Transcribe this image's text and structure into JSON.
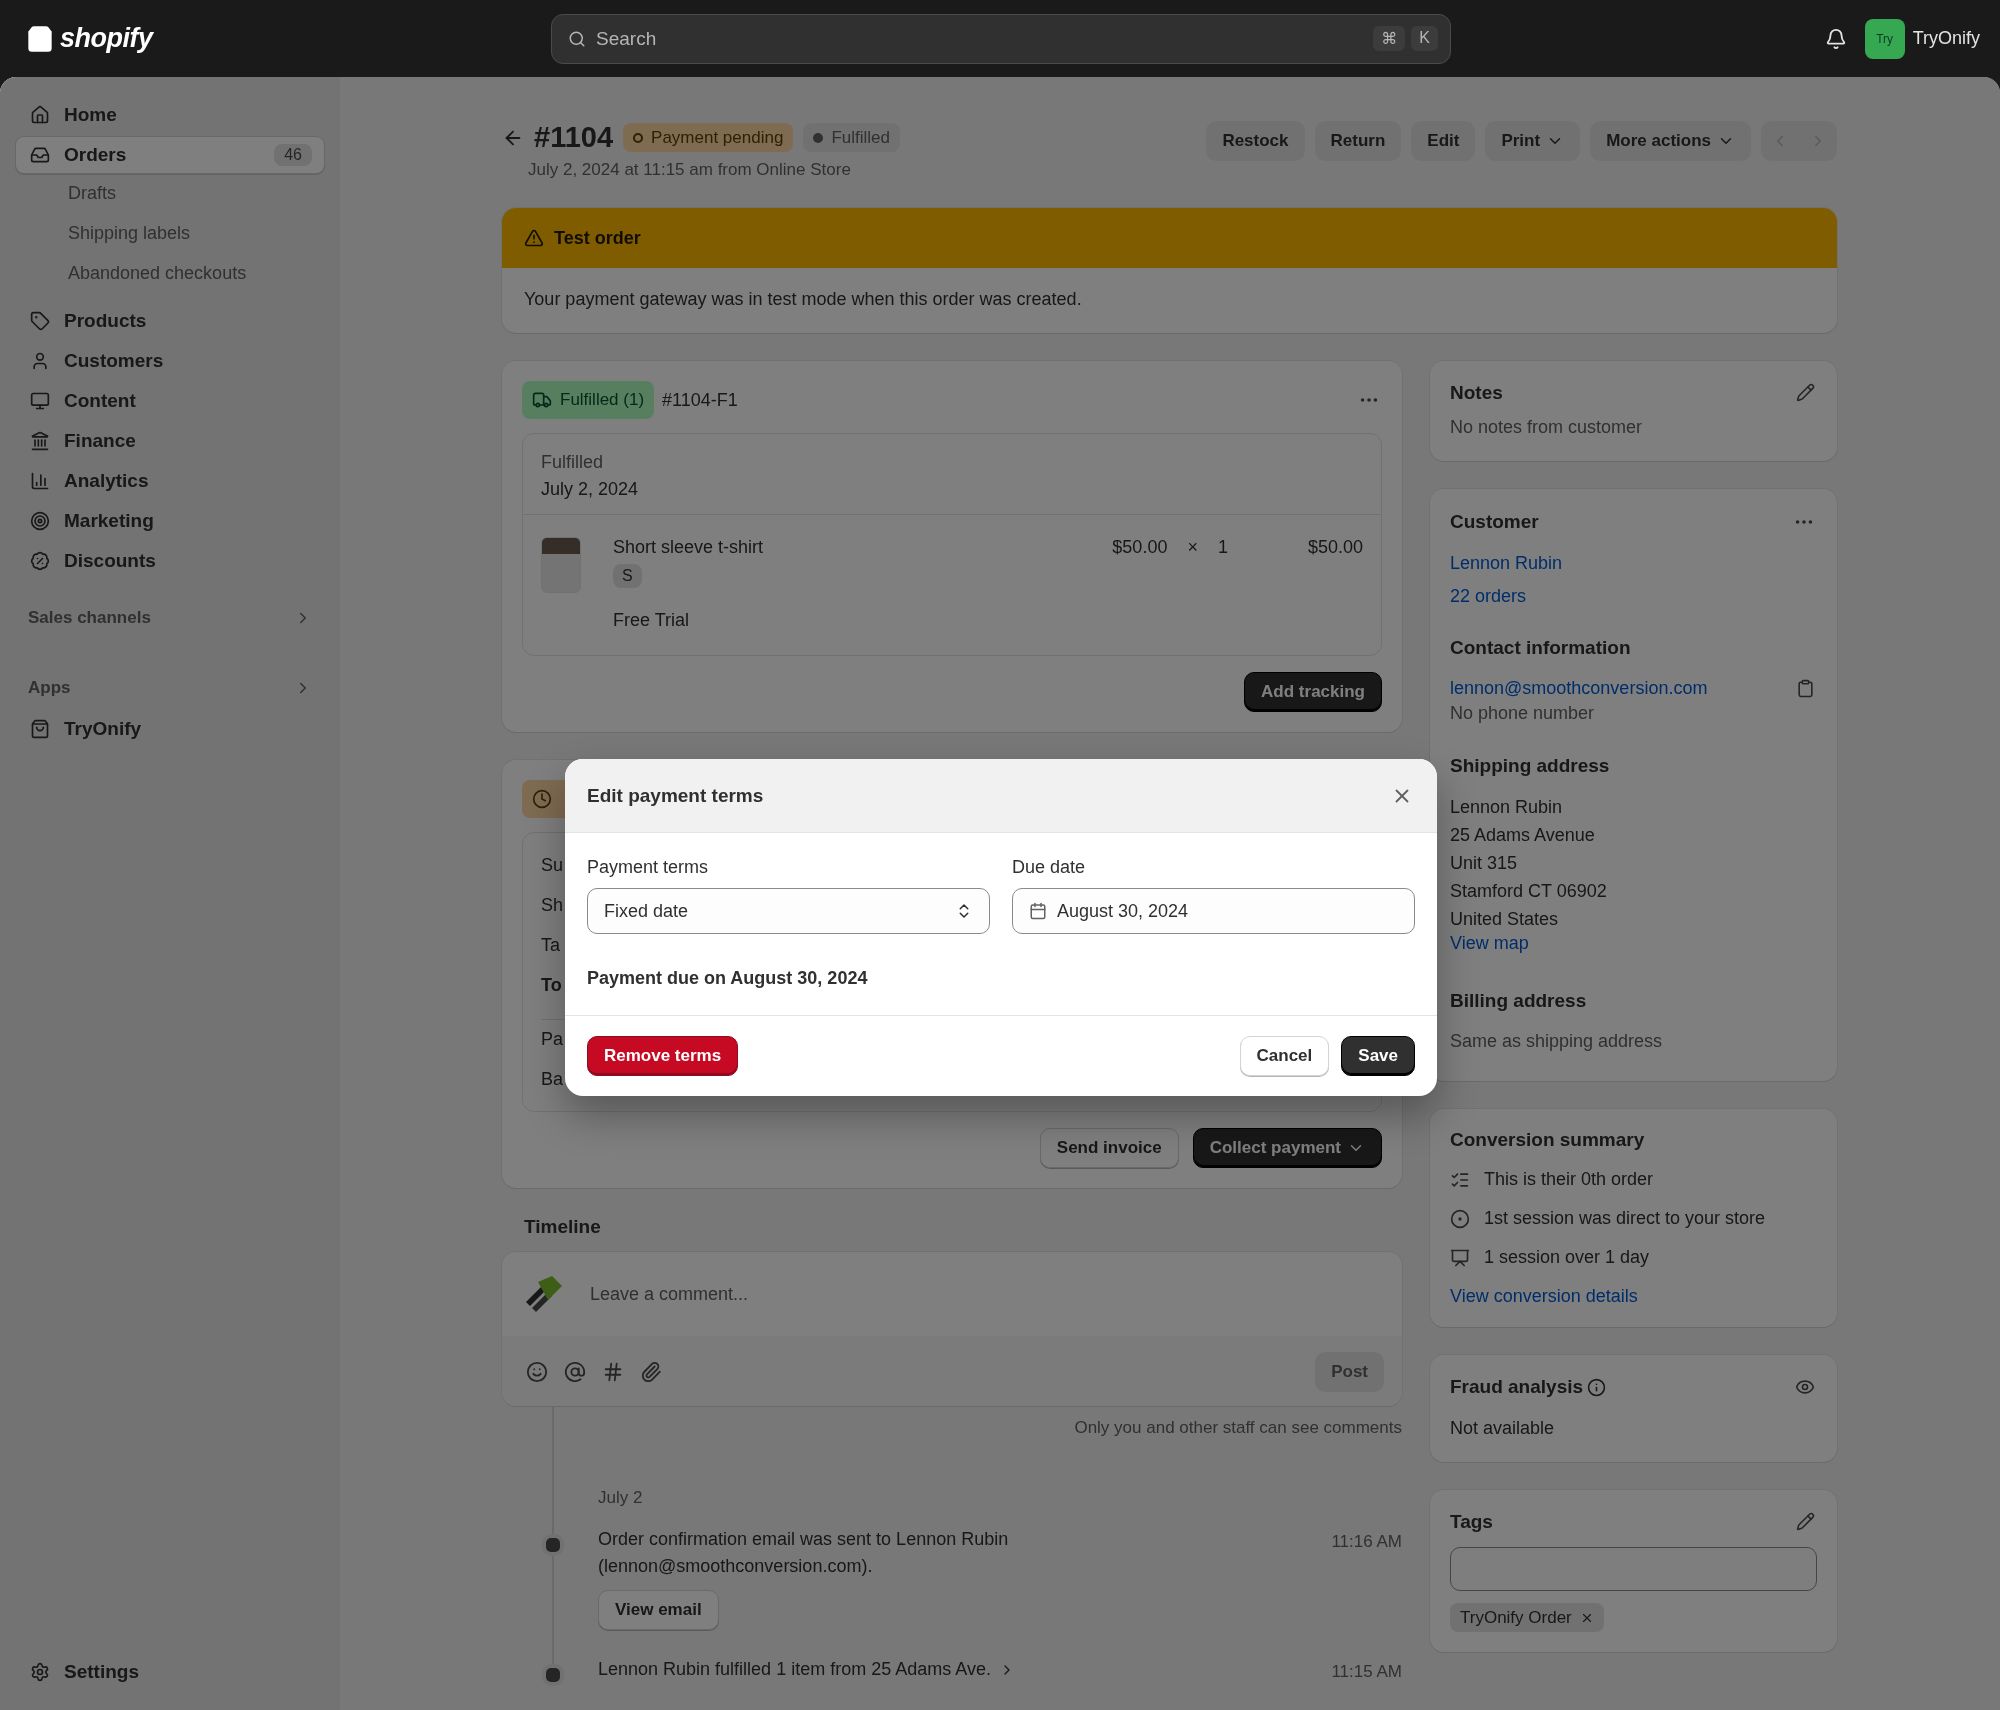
{
  "top_bar": {
    "logo_text": "shopify",
    "search": {
      "placeholder": "Search",
      "shortcut": [
        "⌘",
        "K"
      ]
    },
    "avatar": "Try",
    "store_name": "TryOnify"
  },
  "sidebar": {
    "items": [
      {
        "label": "Home",
        "selected": false
      },
      {
        "label": "Orders",
        "count": "46",
        "selected": true,
        "children": [
          {
            "label": "Drafts",
            "selected": false
          },
          {
            "label": "Shipping labels",
            "selected": false
          },
          {
            "label": "Abandoned checkouts",
            "selected": false
          }
        ]
      },
      {
        "label": "Products",
        "selected": false
      },
      {
        "label": "Customers",
        "selected": false
      },
      {
        "label": "Content",
        "selected": false
      },
      {
        "label": "Finance",
        "selected": false
      },
      {
        "label": "Analytics",
        "selected": false
      },
      {
        "label": "Marketing",
        "selected": false
      },
      {
        "label": "Discounts",
        "selected": false
      }
    ],
    "sections": [
      {
        "title": "Sales channels"
      },
      {
        "title": "Apps",
        "items": [
          {
            "label": "TryOnify",
            "selected": false
          }
        ]
      }
    ],
    "settings": "Settings"
  },
  "order_header": {
    "title": "#1104",
    "badges": [
      {
        "label": "Payment pending",
        "kind": "attention"
      },
      {
        "label": "Fulfilled",
        "kind": "neutral"
      }
    ],
    "subtitle": "July 2, 2024 at 11:15 am from Online Store",
    "actions": [
      {
        "label": "Restock",
        "menu": false
      },
      {
        "label": "Return",
        "menu": false
      },
      {
        "label": "Edit",
        "menu": false
      },
      {
        "label": "Print",
        "menu": true
      },
      {
        "label": "More actions",
        "menu": true
      }
    ]
  },
  "banner": {
    "title": "Test order",
    "text": "Your payment gateway was in test mode when this order was created."
  },
  "fulfillment_card": {
    "badge": "Fulfilled (1)",
    "id": "#1104-F1",
    "status": "Fulfilled",
    "date": "July 2, 2024",
    "line_item": {
      "name": "Short sleeve t-shirt",
      "variant": "S",
      "price": "$50.00",
      "times": "×",
      "quantity": "1",
      "total": "$50.00",
      "note": "Free Trial"
    },
    "button": "Add tracking"
  },
  "payment_card": {
    "rows": [
      {
        "label": "Su",
        "bold": false
      },
      {
        "label": "Sh",
        "bold": false
      },
      {
        "label": "Ta",
        "bold": false
      },
      {
        "label": "To",
        "bold": true
      },
      {
        "label": "Pa",
        "bold": false
      },
      {
        "label": "Ba",
        "bold": false
      }
    ],
    "buttons": [
      {
        "label": "Send invoice",
        "kind": "secondary",
        "menu": false
      },
      {
        "label": "Collect payment",
        "kind": "primary",
        "menu": true
      }
    ]
  },
  "timeline": {
    "title": "Timeline",
    "comment_placeholder": "Leave a comment...",
    "post": {
      "label": "Post",
      "disabled": true
    },
    "caption": "Only you and other staff can see comments",
    "date": "July 2",
    "events": [
      {
        "text": "Order confirmation email was sent to Lennon Rubin (lennon@smoothconversion.com).",
        "time": "11:16 AM",
        "button": "View email",
        "expandable": false
      },
      {
        "text": "Lennon Rubin fulfilled 1 item from 25 Adams Ave.",
        "time": "11:15 AM",
        "expandable": true
      }
    ]
  },
  "notes": {
    "title": "Notes",
    "text": "No notes from customer"
  },
  "customer": {
    "title": "Customer",
    "name": "Lennon Rubin",
    "orders": "22 orders",
    "contact_title": "Contact information",
    "email": "lennon@smoothconversion.com",
    "phone": "No phone number",
    "shipping_title": "Shipping address",
    "shipping_lines": [
      "Lennon Rubin",
      "25 Adams Avenue",
      "Unit 315",
      "Stamford CT 06902",
      "United States"
    ],
    "map_link": "View map",
    "billing_title": "Billing address",
    "billing_text": "Same as shipping address"
  },
  "conversion": {
    "title": "Conversion summary",
    "items": [
      "This is their 0th order",
      "1st session was direct to your store",
      "1 session over 1 day"
    ],
    "link": "View conversion details"
  },
  "fraud": {
    "title": "Fraud analysis",
    "text": "Not available"
  },
  "tags": {
    "title": "Tags",
    "tags": [
      "TryOnify Order"
    ]
  },
  "modal": {
    "title": "Edit payment terms",
    "terms": {
      "label": "Payment terms",
      "value": "Fixed date"
    },
    "due": {
      "label": "Due date",
      "value": "August 30, 2024"
    },
    "summary": "Payment due on August 30, 2024",
    "buttons": [
      {
        "label": "Remove terms",
        "kind": "critical"
      },
      {
        "label": "Cancel",
        "kind": "secondary"
      },
      {
        "label": "Save",
        "kind": "primary"
      }
    ]
  }
}
